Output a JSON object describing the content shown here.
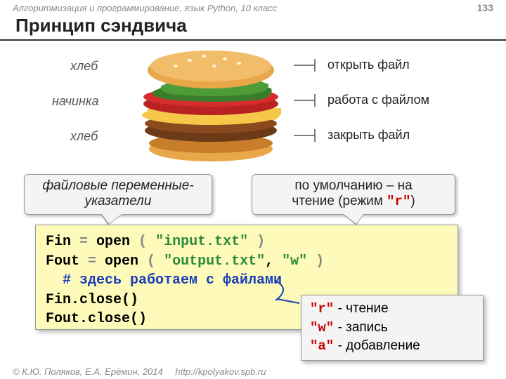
{
  "header": {
    "course": "Алгоритмизация и программирование, язык Python, 10 класс",
    "pagenum": "133"
  },
  "title": "Принцип сэндвича",
  "sandwich": {
    "left1": "хлеб",
    "left2": "начинка",
    "left3": "хлеб",
    "right1": "открыть файл",
    "right2": "работа с  файлом",
    "right3": "закрыть файл"
  },
  "callouts": {
    "c1_l1": "файловые переменные-",
    "c1_l2": "указатели",
    "c2_l1": "по умолчанию – на",
    "c2_l2a": "чтение (режим ",
    "c2_l2b": "\"r\"",
    "c2_l2c": ")"
  },
  "code": {
    "l1a": "Fin",
    "l1b": " = ",
    "l1c": "open",
    "l1d": " ( ",
    "l1e": "\"input.txt\"",
    "l1f": " )",
    "l2a": "Fout",
    "l2b": " = ",
    "l2c": "open",
    "l2d": " ( ",
    "l2e": "\"output.txt\"",
    "l2f": ", ",
    "l2g": "\"w\"",
    "l2h": " )",
    "l3": "  # здесь работаем с файлами",
    "l4": "Fin.close()",
    "l5": "Fout.close()"
  },
  "modes": {
    "r": "\"r\"",
    "rt": " - чтение",
    "w": "\"w\"",
    "wt": " - запись",
    "a": "\"a\"",
    "at": " - добавление"
  },
  "footer": {
    "copy": "© К.Ю. Поляков, Е.А. Ерёмин, 2014",
    "url": "http://kpolyakov.spb.ru"
  }
}
